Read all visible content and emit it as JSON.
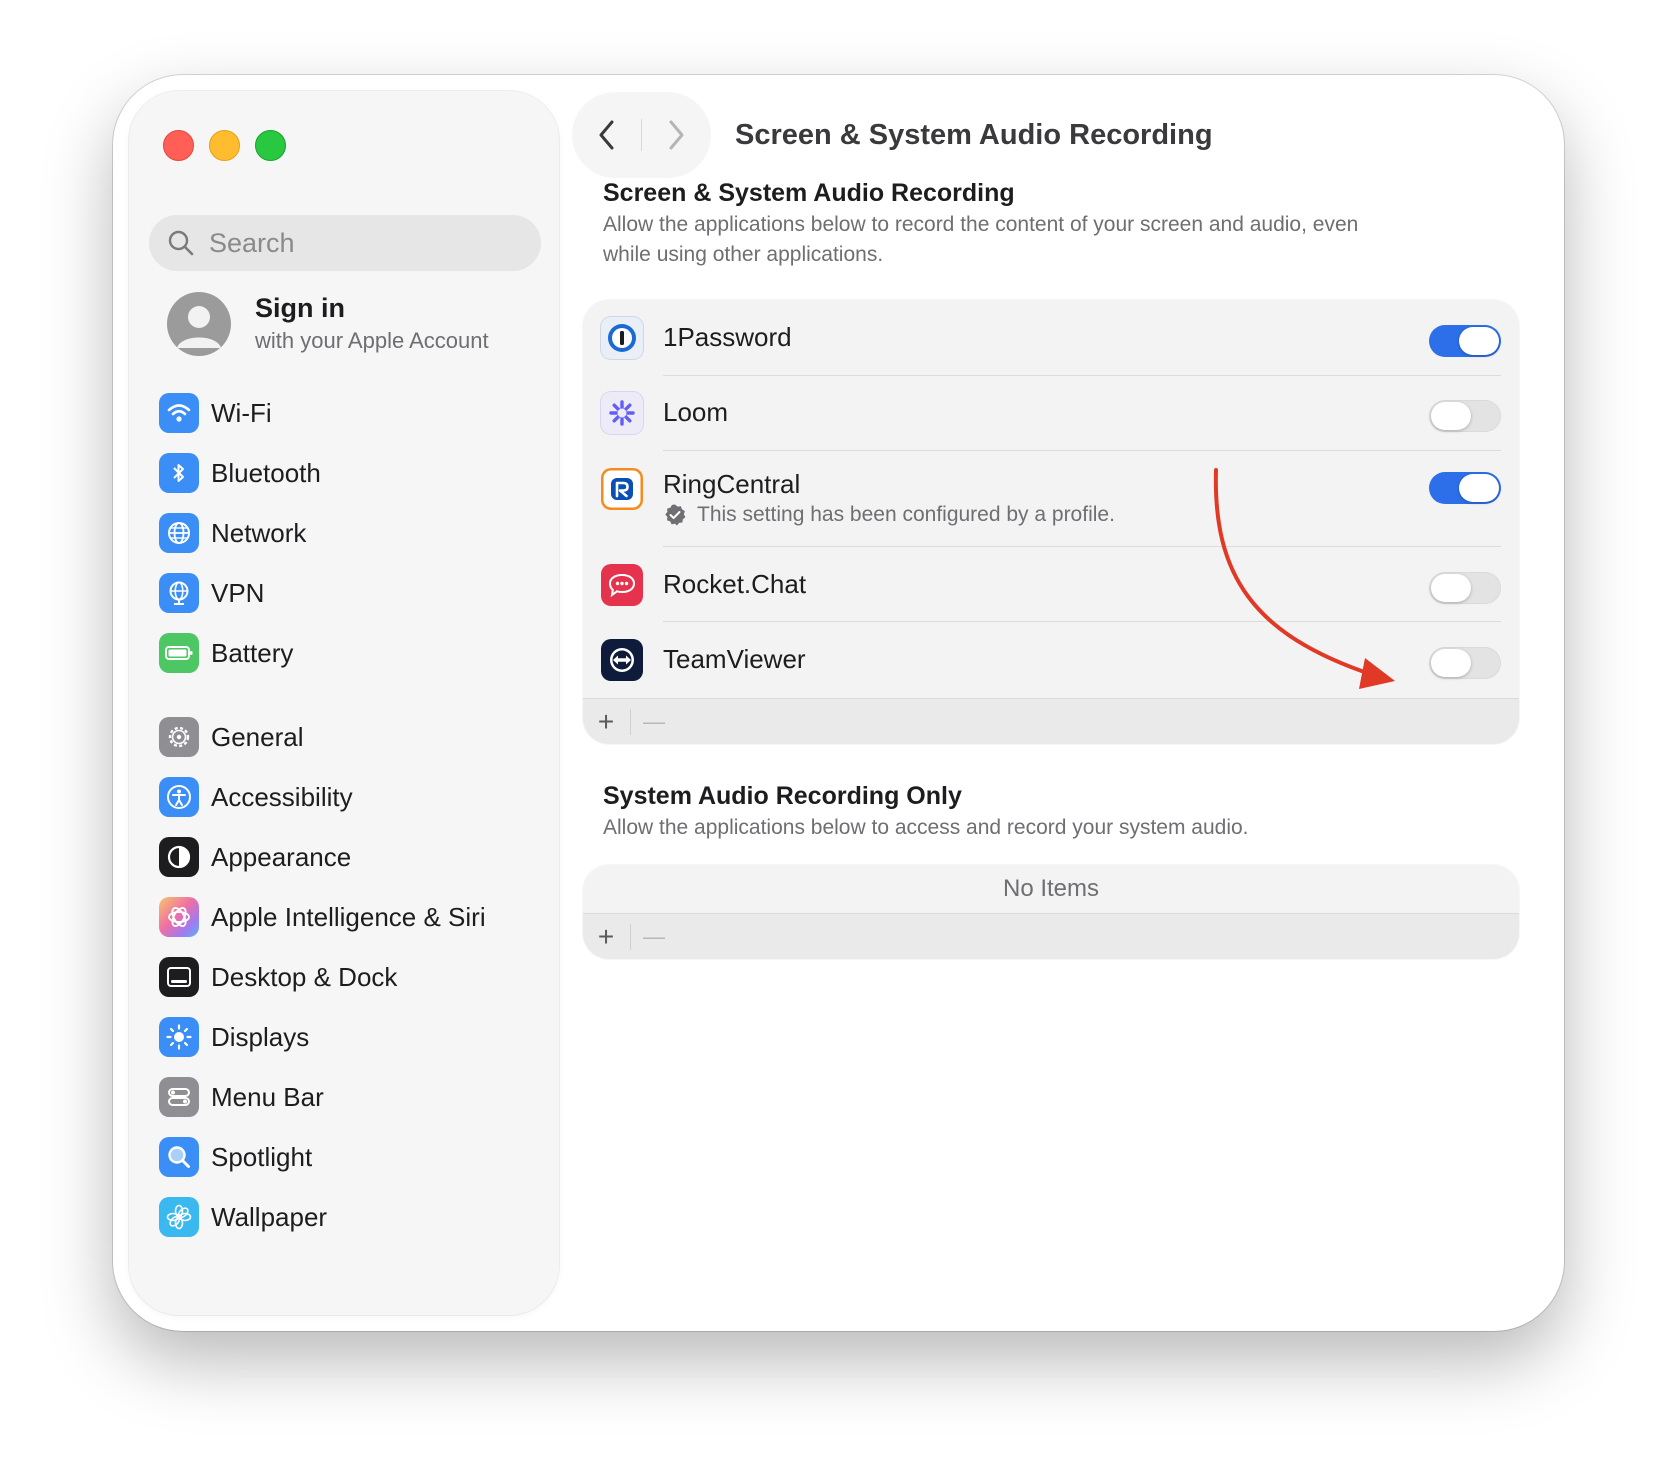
{
  "window": {
    "title": "Screen & System Audio Recording"
  },
  "sidebar": {
    "search_placeholder": "Search",
    "account": {
      "title": "Sign in",
      "subtitle": "with your Apple Account"
    },
    "items": [
      {
        "label": "Wi-Fi",
        "icon": "wifi-icon",
        "color": "#3a8ef6"
      },
      {
        "label": "Bluetooth",
        "icon": "bluetooth-icon",
        "color": "#3a8ef6"
      },
      {
        "label": "Network",
        "icon": "globe-icon",
        "color": "#3a8ef6"
      },
      {
        "label": "VPN",
        "icon": "vpn-globe-icon",
        "color": "#3a8ef6"
      },
      {
        "label": "Battery",
        "icon": "battery-icon",
        "color": "#4cc764"
      },
      {
        "label": "General",
        "icon": "gear-icon",
        "color": "#8e8e93"
      },
      {
        "label": "Accessibility",
        "icon": "accessibility-icon",
        "color": "#3a8ef6"
      },
      {
        "label": "Appearance",
        "icon": "appearance-icon",
        "color": "#1d1d1f"
      },
      {
        "label": "Apple Intelligence & Siri",
        "icon": "siri-icon",
        "color": "#e879a9"
      },
      {
        "label": "Desktop & Dock",
        "icon": "dock-icon",
        "color": "#1d1d1f"
      },
      {
        "label": "Displays",
        "icon": "sun-icon",
        "color": "#3a8ef6"
      },
      {
        "label": "Menu Bar",
        "icon": "menu-bar-icon",
        "color": "#8e8e93"
      },
      {
        "label": "Spotlight",
        "icon": "magnifier-icon",
        "color": "#3a8ef6"
      },
      {
        "label": "Wallpaper",
        "icon": "flower-icon",
        "color": "#3ab8f0"
      }
    ]
  },
  "main": {
    "screen_section": {
      "title": "Screen & System Audio Recording",
      "description_line1": "Allow the applications below to record the content of your screen and audio, even",
      "description_line2": "while using other applications.",
      "apps": [
        {
          "name": "1Password",
          "enabled": true,
          "icon": "onepassword-icon"
        },
        {
          "name": "Loom",
          "enabled": false,
          "icon": "loom-icon"
        },
        {
          "name": "RingCentral",
          "enabled": true,
          "icon": "ringcentral-icon",
          "note": "This setting has been configured by a profile."
        },
        {
          "name": "Rocket.Chat",
          "enabled": false,
          "icon": "rocketchat-icon"
        },
        {
          "name": "TeamViewer",
          "enabled": false,
          "icon": "teamviewer-icon"
        }
      ],
      "add_label": "+",
      "remove_label": "—"
    },
    "audio_section": {
      "title": "System Audio Recording Only",
      "description": "Allow the applications below to access and record your system audio.",
      "empty_label": "No Items",
      "add_label": "+",
      "remove_label": "—"
    }
  },
  "colors": {
    "accent": "#2c6fe8",
    "annotation_arrow": "#e03a26"
  }
}
